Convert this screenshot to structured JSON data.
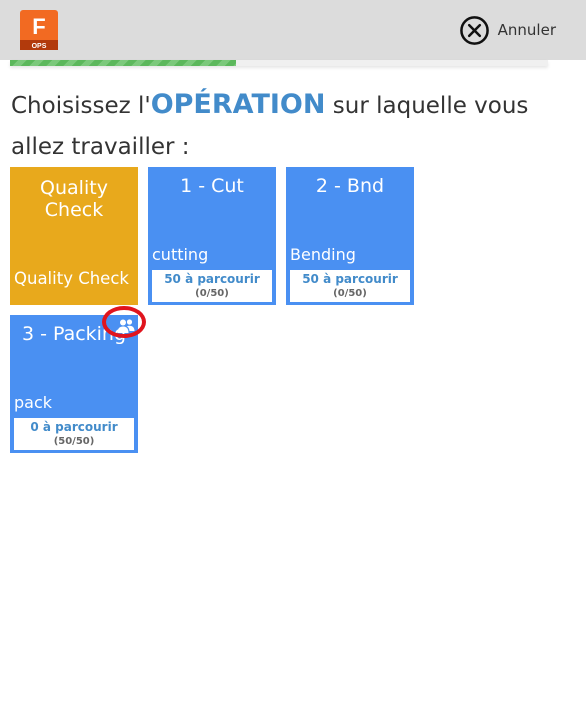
{
  "app": {
    "logo_letter": "F",
    "logo_caption": "OPS",
    "cancel_label": "Annuler"
  },
  "progress": {
    "value_percent": 42
  },
  "heading": {
    "prefix": "Choisissez l'",
    "highlight": "OPÉRATION",
    "suffix": " sur laquelle vous allez travailler :"
  },
  "operations": [
    {
      "title": "Quality Check",
      "description": "Quality Check",
      "color": "#e8a91c",
      "remaining": "",
      "progress": ""
    },
    {
      "title": "1 - Cut",
      "description": "cutting",
      "color": "#4a90f2",
      "remaining": "50 à parcourir",
      "progress": "(0/50)"
    },
    {
      "title": "2 - Bnd",
      "description": "Bending",
      "color": "#4a90f2",
      "remaining": "50 à parcourir",
      "progress": "(0/50)"
    },
    {
      "title": "3 - Packing",
      "description": "pack",
      "color": "#4a90f2",
      "remaining": "0 à parcourir",
      "progress": "(50/50)",
      "icon": "users-icon"
    }
  ],
  "colors": {
    "topbar": "#dcdcdc",
    "accent": "#428bca",
    "tile_blue": "#4a90f2",
    "tile_orange": "#e8a91c",
    "annotation_red": "#e0141e",
    "progress_green": "#5cb85c"
  }
}
